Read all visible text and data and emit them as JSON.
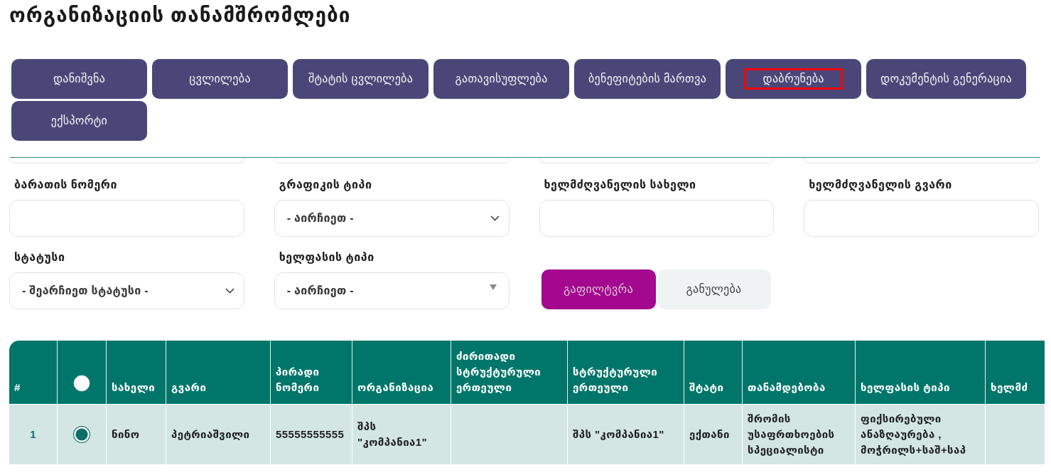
{
  "page": {
    "title": "ორგანიზაციის თანამშრომლები"
  },
  "actions": [
    {
      "label": "დანიშვნა",
      "highlighted": false
    },
    {
      "label": "ცვლილება",
      "highlighted": false
    },
    {
      "label": "შტატის ცვლილება",
      "highlighted": false
    },
    {
      "label": "გათავისუფლება",
      "highlighted": false
    },
    {
      "label": "ბენეფიტების მართვა",
      "highlighted": false
    },
    {
      "label": "დაბრუნება",
      "highlighted": true
    },
    {
      "label": "დოკუმენტის გენერაცია",
      "highlighted": false
    },
    {
      "label": "ექსპორტი",
      "highlighted": false
    }
  ],
  "filters": {
    "fields": [
      {
        "label": "ბარათის ნომერი",
        "kind": "input"
      },
      {
        "label": "გრაფიკის ტიპი",
        "kind": "select",
        "value": "- აირჩიეთ -"
      },
      {
        "label": "ხელმძღვანელის სახელი",
        "kind": "input"
      },
      {
        "label": "ხელმძღვანელის გვარი",
        "kind": "input"
      },
      {
        "label": "სტატუსი",
        "kind": "select",
        "value": "- შეარჩიეთ სტატუსი -"
      },
      {
        "label": "ხელფასის ტიპი",
        "kind": "combobox",
        "value": "- აირჩიეთ -"
      }
    ],
    "buttons": [
      {
        "label": "გაფილტვრა",
        "kind": "primary"
      },
      {
        "label": "განულება",
        "kind": "secondary"
      }
    ]
  },
  "table": {
    "columns": [
      {
        "kind": "index",
        "label": "#"
      },
      {
        "kind": "radio",
        "checked": false
      },
      {
        "kind": "text",
        "label": "სახელი"
      },
      {
        "kind": "text",
        "label": "გვარი"
      },
      {
        "kind": "text",
        "label": "პირადი ნომერი"
      },
      {
        "kind": "text",
        "label": "ორგანიზაცია"
      },
      {
        "kind": "text",
        "label": "ძირითადი სტრუქტურული ერთეული"
      },
      {
        "kind": "text",
        "label": "სტრუქტურული ერთეული"
      },
      {
        "kind": "text",
        "label": "შტატი"
      },
      {
        "kind": "text",
        "label": "თანამდებობა"
      },
      {
        "kind": "text",
        "label": "ხელფასის ტიპი"
      },
      {
        "kind": "text",
        "label": "ხელმძ"
      }
    ],
    "rows": [
      {
        "selected": true,
        "cells": [
          "1",
          null,
          "ნინო",
          "პეტრიაშვილი",
          "55555555555",
          "შპს \"კომპანია1\"",
          null,
          "შპს \"კომპანია1\"",
          "ექთანი",
          "შრომის უსაფრთხოების სპეციალისტი",
          "ფიქსირებული ანაზღაურება , მოჭრილს+საშ+საპ",
          null
        ]
      }
    ]
  }
}
